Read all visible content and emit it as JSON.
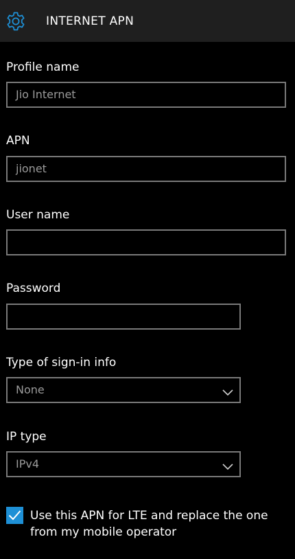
{
  "header": {
    "title": "INTERNET APN",
    "icon": "gear-icon",
    "accent": "#1e90d6"
  },
  "form": {
    "profile_name": {
      "label": "Profile name",
      "value": "Jio Internet"
    },
    "apn": {
      "label": "APN",
      "value": "jionet"
    },
    "user_name": {
      "label": "User name",
      "value": ""
    },
    "password": {
      "label": "Password",
      "value": ""
    },
    "sign_in_type": {
      "label": "Type of sign-in info",
      "selected": "None"
    },
    "ip_type": {
      "label": "IP type",
      "selected": "IPv4"
    },
    "lte_apn": {
      "checked": true,
      "label": "Use this APN for LTE and replace the one from my mobile operator"
    }
  }
}
